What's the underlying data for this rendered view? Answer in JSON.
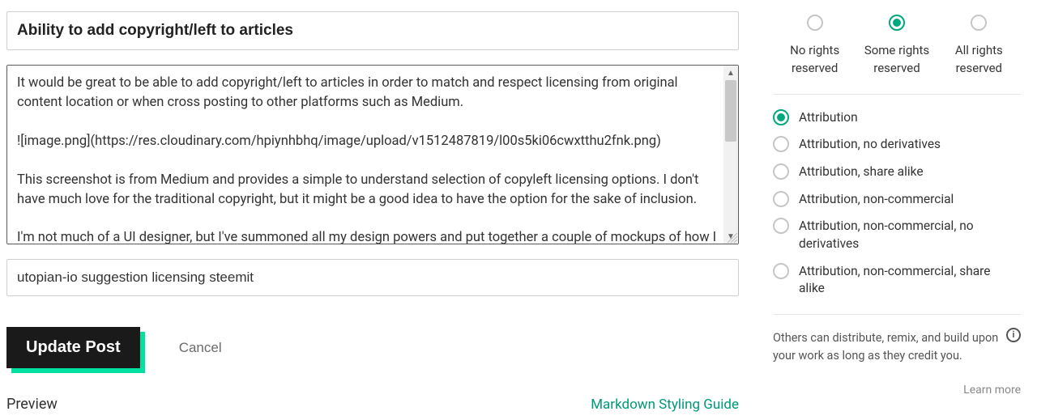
{
  "editor": {
    "title": "Ability to add copyright/left to articles",
    "body": "It would be great to be able to add copyright/left to articles in order to match and respect licensing from original content location or when cross posting to other platforms such as Medium.\n\n![image.png](https://res.cloudinary.com/hpiynhbhq/image/upload/v1512487819/l00s5ki06cwxtthu2fnk.png)\n\nThis screenshot is from Medium and provides a simple to understand selection of copyleft licensing options. I don't have much love for the traditional copyright, but it might be a good idea to have the option for the sake of inclusion.\n\nI'm not much of a UI designer, but I've summoned all my design powers and put together a couple of mockups of how I think it could look like.",
    "tags": "utopian-io suggestion licensing steemit"
  },
  "actions": {
    "update": "Update Post",
    "cancel": "Cancel"
  },
  "footer": {
    "preview": "Preview",
    "guide": "Markdown Styling Guide"
  },
  "rights": {
    "top": [
      {
        "label": "No rights reserved",
        "selected": false
      },
      {
        "label": "Some rights reserved",
        "selected": true
      },
      {
        "label": "All rights reserved",
        "selected": false
      }
    ],
    "cc": [
      {
        "label": "Attribution",
        "selected": true
      },
      {
        "label": "Attribution, no derivatives",
        "selected": false
      },
      {
        "label": "Attribution, share alike",
        "selected": false
      },
      {
        "label": "Attribution, non-commercial",
        "selected": false
      },
      {
        "label": "Attribution, non-commercial, no derivatives",
        "selected": false
      },
      {
        "label": "Attribution, non-commercial, share alike",
        "selected": false
      }
    ],
    "description": "Others can distribute, remix, and build upon your work as long as they credit you.",
    "learn_more": "Learn more"
  }
}
